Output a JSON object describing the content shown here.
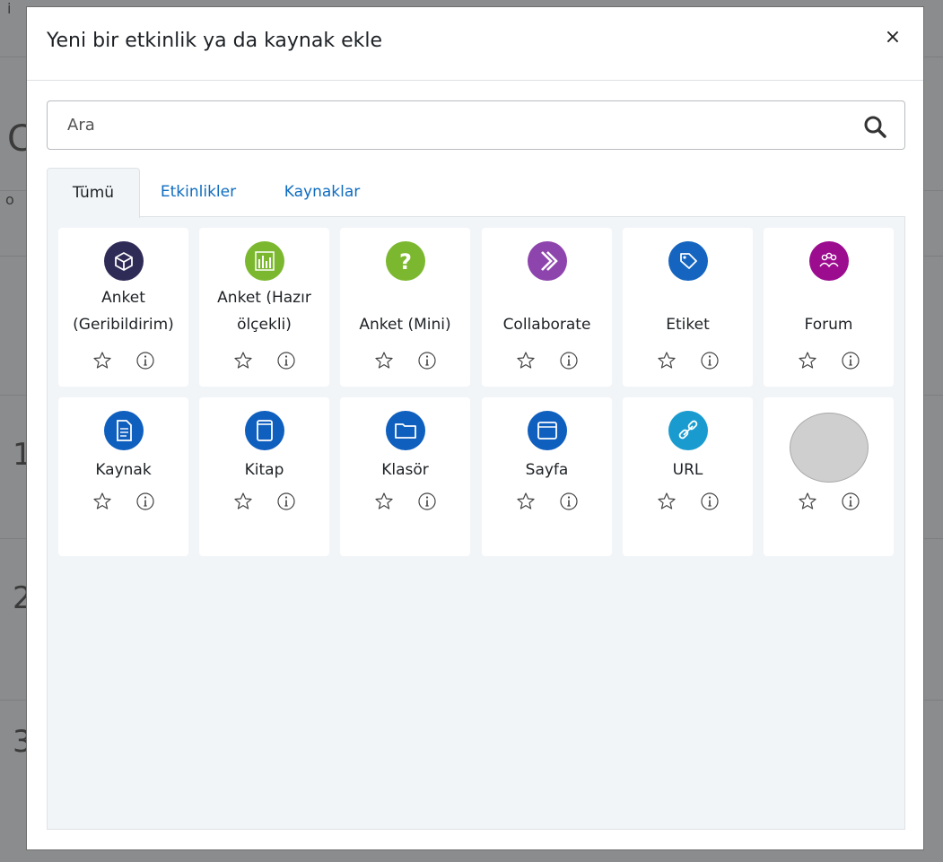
{
  "modal": {
    "title": "Yeni bir etkinlik ya da kaynak ekle",
    "close_label": "×"
  },
  "search": {
    "placeholder": "Ara",
    "value": ""
  },
  "tabs": [
    {
      "label": "Tümü",
      "active": true
    },
    {
      "label": "Etkinlikler",
      "active": false
    },
    {
      "label": "Kaynaklar",
      "active": false
    }
  ],
  "modules": [
    {
      "label_lines": [
        "Anket",
        "(Geribildirim)"
      ],
      "icon": "feedback-icon",
      "color": "#2f2b57"
    },
    {
      "label_lines": [
        "Anket (Hazır",
        "ölçekli)"
      ],
      "icon": "survey-chart-icon",
      "color": "#7cb82f"
    },
    {
      "label_lines": [
        "Anket (Mini)"
      ],
      "icon": "question-icon",
      "color": "#7cb82f"
    },
    {
      "label_lines": [
        "Collaborate"
      ],
      "icon": "collaborate-icon",
      "color": "#8e44ad"
    },
    {
      "label_lines": [
        "Etiket"
      ],
      "icon": "tag-icon",
      "color": "#1565c0"
    },
    {
      "label_lines": [
        "Forum"
      ],
      "icon": "forum-icon",
      "color": "#9c0c8f"
    },
    {
      "label_lines": [
        "Kaynak"
      ],
      "icon": "file-icon",
      "color": "#0f5fbf"
    },
    {
      "label_lines": [
        "Kitap"
      ],
      "icon": "book-icon",
      "color": "#0f5fbf"
    },
    {
      "label_lines": [
        "Klasör"
      ],
      "icon": "folder-icon",
      "color": "#0f5fbf"
    },
    {
      "label_lines": [
        "Sayfa"
      ],
      "icon": "page-icon",
      "color": "#0f5fbf"
    },
    {
      "label_lines": [
        "URL"
      ],
      "icon": "link-icon",
      "color": "#1a9bd0"
    },
    {
      "label_lines": [],
      "icon": "placeholder-image-icon",
      "color": "#cfcfcf"
    }
  ]
}
